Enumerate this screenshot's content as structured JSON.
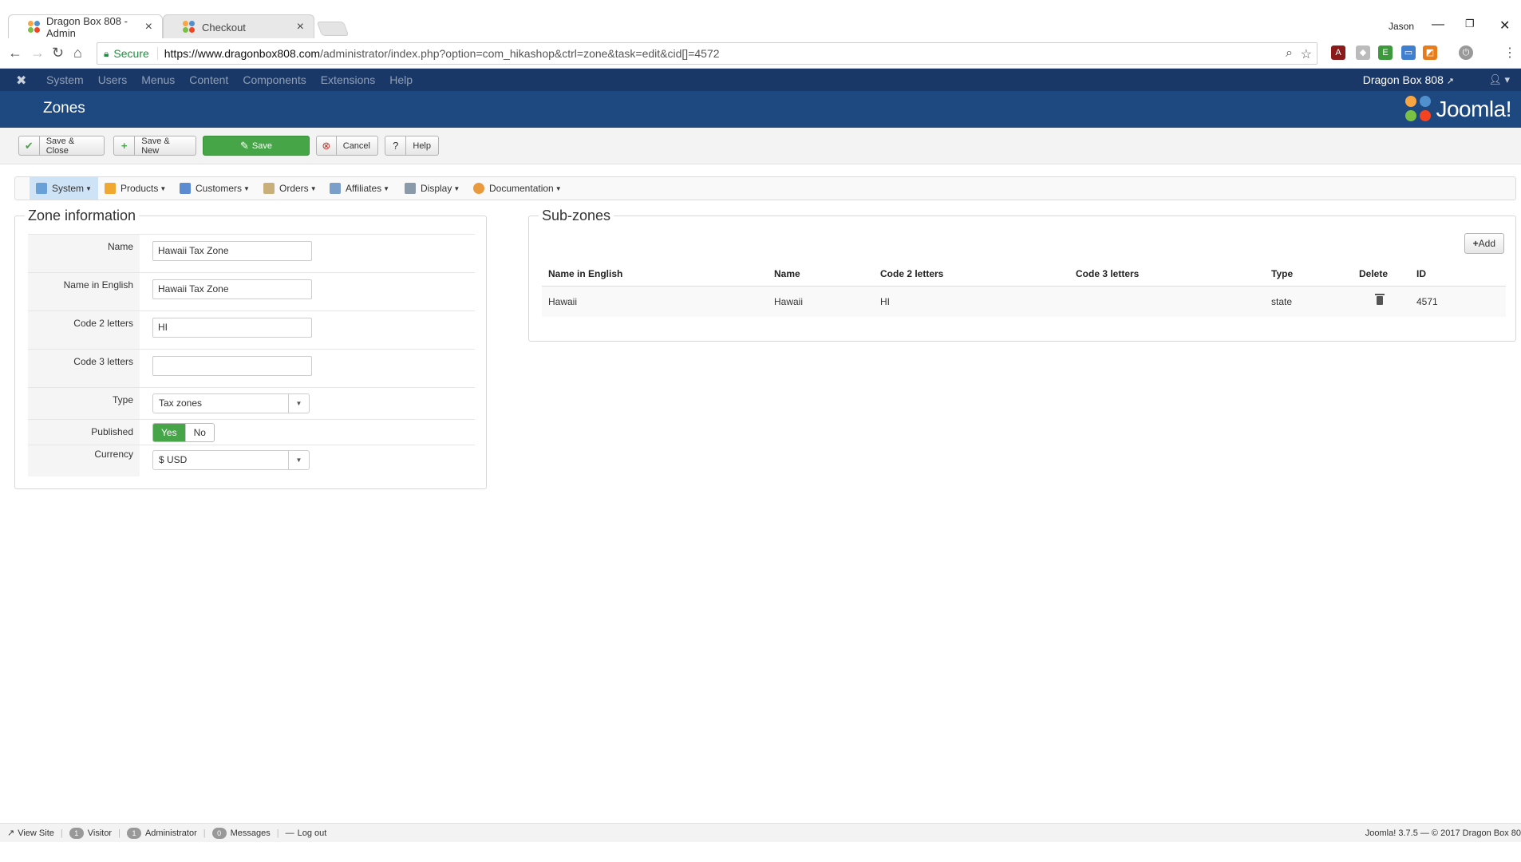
{
  "browser": {
    "tabs": [
      {
        "title": "Dragon Box 808 - Admin"
      },
      {
        "title": "Checkout"
      }
    ],
    "window_user": "Jason",
    "secure_label": "Secure",
    "url_host": "https://www.dragonbox808.com",
    "url_path": "/administrator/index.php?option=com_hikashop&ctrl=zone&task=edit&cid[]=4572"
  },
  "joomla_nav": {
    "items": [
      "System",
      "Users",
      "Menus",
      "Content",
      "Components",
      "Extensions",
      "Help"
    ],
    "site_name": "Dragon Box 808"
  },
  "header": {
    "title": "Zones",
    "logo_text": "Joomla!"
  },
  "toolbar": {
    "save_close": "Save & Close",
    "save_new": "Save & New",
    "save": "Save",
    "cancel": "Cancel",
    "help": "Help"
  },
  "hika_menu": {
    "items": [
      "System",
      "Products",
      "Customers",
      "Orders",
      "Affiliates",
      "Display",
      "Documentation"
    ]
  },
  "zone_info": {
    "legend": "Zone information",
    "fields": {
      "name_label": "Name",
      "name_value": "Hawaii Tax Zone",
      "name_en_label": "Name in English",
      "name_en_value": "Hawaii Tax Zone",
      "code2_label": "Code 2 letters",
      "code2_value": "HI",
      "code3_label": "Code 3 letters",
      "code3_value": "",
      "type_label": "Type",
      "type_value": "Tax zones",
      "published_label": "Published",
      "published_yes": "Yes",
      "published_no": "No",
      "currency_label": "Currency",
      "currency_value": "$ USD"
    }
  },
  "subzones": {
    "legend": "Sub-zones",
    "add_label": "Add",
    "columns": [
      "Name in English",
      "Name",
      "Code 2 letters",
      "Code 3 letters",
      "Type",
      "Delete",
      "ID"
    ],
    "rows": [
      {
        "name_en": "Hawaii",
        "name": "Hawaii",
        "code2": "HI",
        "code3": "",
        "type": "state",
        "id": "4571"
      }
    ]
  },
  "statusbar": {
    "view_site": "View Site",
    "visitor_count": "1",
    "visitor_label": "Visitor",
    "admin_count": "1",
    "admin_label": "Administrator",
    "messages_count": "0",
    "messages_label": "Messages",
    "logout": "Log out",
    "version": "Joomla! 3.7.5 — © 2017 Dragon Box 80"
  },
  "colors": {
    "joomla_nav": "#1a3867",
    "joomla_header": "#1e4880",
    "save_green": "#46a546",
    "active_menu": "#cfe3f6"
  }
}
